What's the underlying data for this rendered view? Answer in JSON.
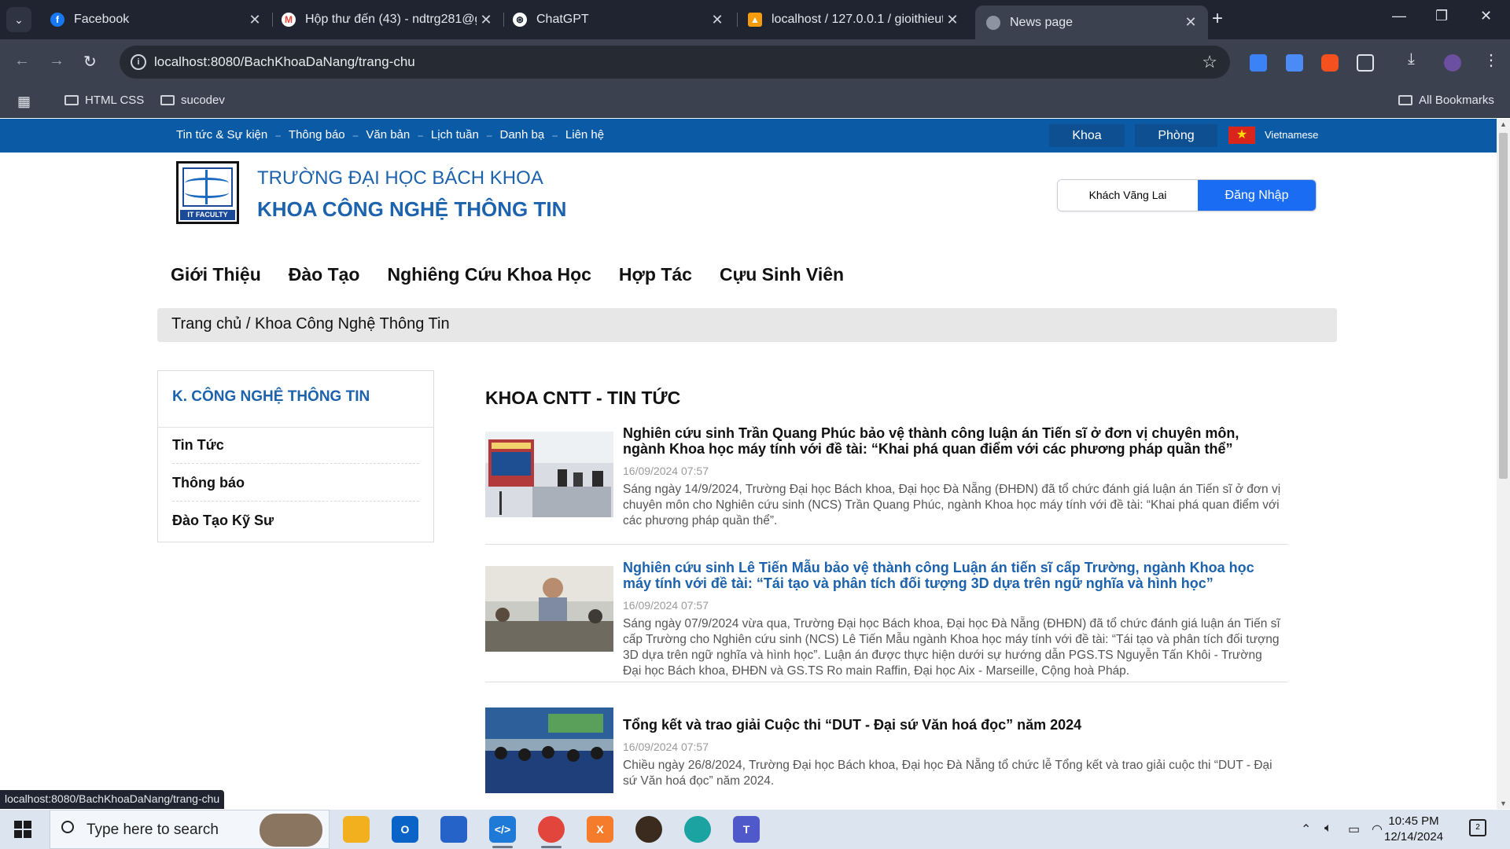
{
  "browser": {
    "tabs": [
      {
        "title": "Facebook",
        "icon": "facebook-icon",
        "color": "#1877f2"
      },
      {
        "title": "Hộp thư đến (43) - ndtrg281@g",
        "icon": "gmail-icon",
        "color": "#ea4335"
      },
      {
        "title": "ChatGPT",
        "icon": "chatgpt-icon",
        "color": "#10a37f"
      },
      {
        "title": "localhost / 127.0.0.1 / gioithieut",
        "icon": "phpmyadmin-icon",
        "color": "#f89c0e"
      },
      {
        "title": "News page",
        "icon": "globe-icon",
        "color": "#8d93a0"
      }
    ],
    "url": "localhost:8080/BachKhoaDaNang/trang-chu",
    "bookmarks": [
      "HTML CSS",
      "sucodev"
    ],
    "all_bookmarks": "All Bookmarks",
    "status_url": "localhost:8080/BachKhoaDaNang/trang-chu"
  },
  "site": {
    "top_links": [
      "Tin tức & Sự kiện",
      "Thông báo",
      "Văn bản",
      "Lịch tuần",
      "Danh bạ",
      "Liên hệ"
    ],
    "top_buttons": {
      "khoa": "Khoa",
      "phong": "Phòng"
    },
    "language": "Vietnamese",
    "flag_star": "★",
    "logo_caption": "IT FACULTY",
    "school_line1": "TRƯỜNG ĐẠI HỌC BÁCH KHOA",
    "school_line2": "KHOA CÔNG NGHỆ THÔNG TIN",
    "auth": {
      "guest": "Khách Vãng Lai",
      "login": "Đăng Nhập"
    },
    "main_nav": [
      "Giới Thiệu",
      "Đào Tạo",
      "Nghiêng Cứu Khoa Học",
      "Hợp Tác",
      "Cựu Sinh Viên"
    ],
    "breadcrumb": "Trang chủ / Khoa Công Nghệ Thông Tin",
    "sidebar": {
      "title": "K. CÔNG NGHỆ THÔNG TIN",
      "items": [
        "Tin Tức",
        "Thông báo",
        "Đào Tạo Kỹ Sư"
      ]
    },
    "news_heading": "KHOA CNTT - TIN TỨC",
    "news": [
      {
        "title": "Nghiên cứu sinh Trần Quang Phúc bảo vệ thành công luận án Tiến sĩ ở đơn vị chuyên môn, ngành Khoa học máy tính với đề tài: “Khai phá quan điểm với các phương pháp quần thể”",
        "date": "16/09/2024 07:57",
        "summary": "Sáng ngày 14/9/2024, Trường Đại học Bách khoa, Đại học Đà Nẵng (ĐHĐN) đã tổ chức đánh giá luận án Tiến sĩ ở đơn vị chuyên môn cho Nghiên cứu sinh (NCS) Trần Quang Phúc, ngành Khoa học máy tính với đề tài: “Khai phá quan điểm với các phương pháp quần thể”."
      },
      {
        "title": "Nghiên cứu sinh Lê Tiến Mẫu bảo vệ thành công Luận án tiến sĩ cấp Trường, ngành Khoa học máy tính với đề tài: “Tái tạo và phân tích đối tượng 3D dựa trên ngữ nghĩa và hình học”",
        "date": "16/09/2024 07:57",
        "summary": "Sáng ngày 07/9/2024 vừa qua, Trường Đại học Bách khoa, Đại học Đà Nẵng (ĐHĐN) đã tổ chức đánh giá luận án Tiến sĩ cấp Trường cho Nghiên cứu sinh (NCS) Lê Tiến Mẫu ngành Khoa học máy tính với đề tài: “Tái tạo và phân tích đối tượng 3D dựa trên ngữ nghĩa và hình học”. Luận án được thực hiện dưới sự hướng dẫn PGS.TS Nguyễn Tấn Khôi - Trường Đại học Bách khoa, ĐHĐN và GS.TS Ro main Raffin, Đại học Aix - Marseille, Cộng hoà Pháp."
      },
      {
        "title": "Tổng kết và trao giải Cuộc thi “DUT - Đại sứ Văn hoá đọc” năm 2024",
        "date": "16/09/2024 07:57",
        "summary": "Chiều ngày 26/8/2024, Trường Đại học Bách khoa, Đại học Đà Nẵng tổ chức lễ Tổng kết và trao giải cuộc thi “DUT - Đại sứ Văn hoá đọc” năm 2024."
      }
    ]
  },
  "taskbar": {
    "search_placeholder": "Type here to search",
    "time": "10:45 PM",
    "date": "12/14/2024",
    "notifications": "2"
  }
}
